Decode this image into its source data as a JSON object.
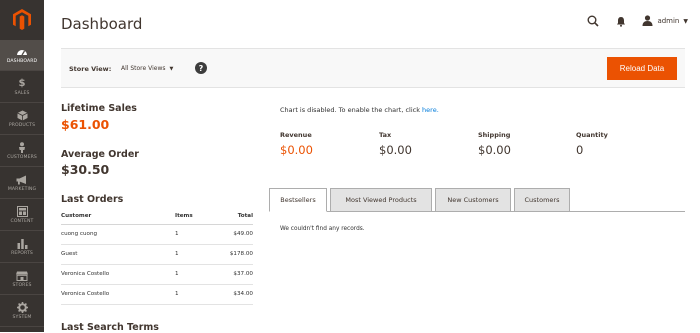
{
  "sidebar": {
    "items": [
      {
        "label": "DASHBOARD",
        "icon": "dashboard-icon"
      },
      {
        "label": "SALES",
        "icon": "dollar-icon"
      },
      {
        "label": "PRODUCTS",
        "icon": "cube-icon"
      },
      {
        "label": "CUSTOMERS",
        "icon": "person-icon"
      },
      {
        "label": "MARKETING",
        "icon": "megaphone-icon"
      },
      {
        "label": "CONTENT",
        "icon": "layout-icon"
      },
      {
        "label": "REPORTS",
        "icon": "bar-chart-icon"
      },
      {
        "label": "STORES",
        "icon": "storefront-icon"
      },
      {
        "label": "SYSTEM",
        "icon": "gear-icon"
      }
    ]
  },
  "header": {
    "title": "Dashboard",
    "user": "admin"
  },
  "store_bar": {
    "label": "Store View:",
    "selected": "All Store Views",
    "help": "?",
    "reload": "Reload Data"
  },
  "stats": {
    "lifetime_sales_label": "Lifetime Sales",
    "lifetime_sales_value": "$61.00",
    "average_order_label": "Average Order",
    "average_order_value": "$30.50"
  },
  "last_orders": {
    "title": "Last Orders",
    "headers": [
      "Customer",
      "Items",
      "Total"
    ],
    "rows": [
      [
        "cuong cuong",
        "1",
        "$49.00"
      ],
      [
        "Guest",
        "1",
        "$178.00"
      ],
      [
        "Veronica Costello",
        "1",
        "$37.00"
      ],
      [
        "Veronica Costello",
        "1",
        "$34.00"
      ]
    ]
  },
  "last_search_title": "Last Search Terms",
  "chart": {
    "message": "Chart is disabled. To enable the chart, click ",
    "link": "here."
  },
  "totals": [
    {
      "label": "Revenue",
      "value": "$0.00"
    },
    {
      "label": "Tax",
      "value": "$0.00"
    },
    {
      "label": "Shipping",
      "value": "$0.00"
    },
    {
      "label": "Quantity",
      "value": "0"
    }
  ],
  "tabs": [
    "Bestsellers",
    "Most Viewed Products",
    "New Customers",
    "Customers"
  ],
  "no_records": "We couldn't find any records.",
  "colors": {
    "accent": "#eb5202",
    "sidebar": "#373330",
    "link": "#007bdb"
  }
}
